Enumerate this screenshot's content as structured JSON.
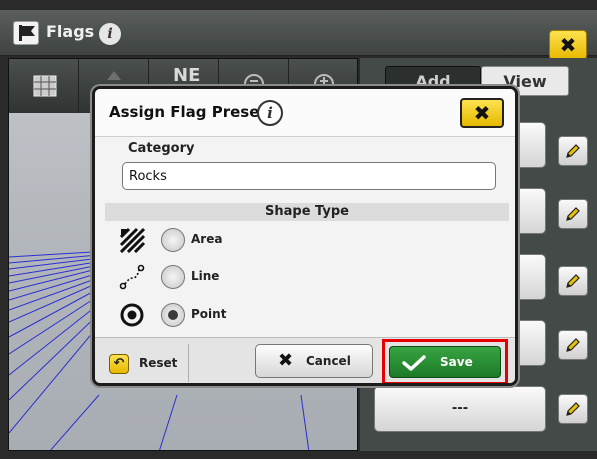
{
  "titlebar": {
    "title": "Flags",
    "close_symbol": "✖"
  },
  "map": {
    "heading_label": "NE"
  },
  "right_panel": {
    "tabs": [
      {
        "label": "Add"
      },
      {
        "label": "View"
      }
    ],
    "presets": [
      {
        "label": ""
      },
      {
        "label": ""
      },
      {
        "label": ""
      },
      {
        "label": ""
      },
      {
        "label": "---"
      }
    ]
  },
  "dialog": {
    "title": "Assign Flag Preset",
    "info_symbol": "i",
    "close_symbol": "✖",
    "category_label": "Category",
    "category_value": "Rocks",
    "shape_type_label": "Shape Type",
    "shapes": [
      {
        "label": "Area",
        "selected": false,
        "icon": "area-hatch-icon"
      },
      {
        "label": "Line",
        "selected": false,
        "icon": "line-icon"
      },
      {
        "label": "Point",
        "selected": true,
        "icon": "point-icon"
      }
    ],
    "reset_label": "Reset",
    "cancel_label": "Cancel",
    "save_label": "Save"
  },
  "colors": {
    "accent_yellow": "#f5cc17",
    "save_green": "#2a8f35",
    "highlight_red": "#e60000"
  }
}
